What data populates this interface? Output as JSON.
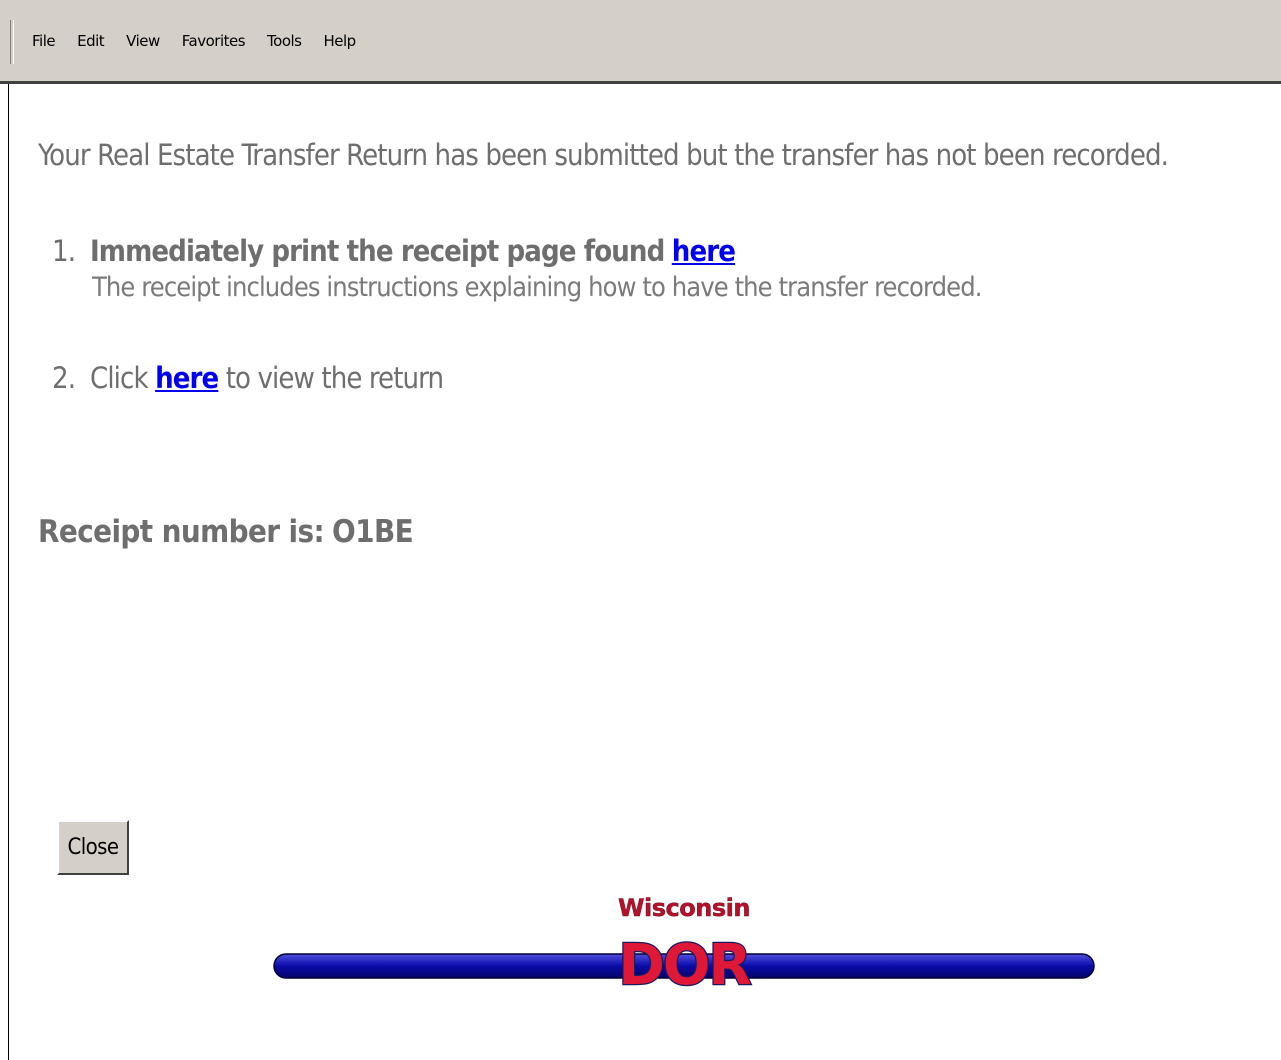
{
  "menu": [
    "File",
    "Edit",
    "View",
    "Favorites",
    "Tools",
    "Help"
  ],
  "intro": "Your Real Estate Transfer Return has been submitted but the transfer has not been recorded.",
  "step1": {
    "number": "1.",
    "text": "Immediately print the receipt page found",
    "link": "here",
    "note": "The receipt includes instructions explaining how to have the transfer recorded."
  },
  "step2": {
    "number": "2.",
    "before": "Click",
    "link": "here",
    "after": "to view the return"
  },
  "receipt": {
    "label": "Receipt number is:",
    "value": "O1BE"
  },
  "close_label": "Close",
  "logo": {
    "top": "Wisconsin",
    "main": "DOR"
  },
  "colors": {
    "link": "#0000ee",
    "text": "#6e6e6e",
    "logo_red": "#cc1133",
    "logo_bar": "#1010b0"
  }
}
